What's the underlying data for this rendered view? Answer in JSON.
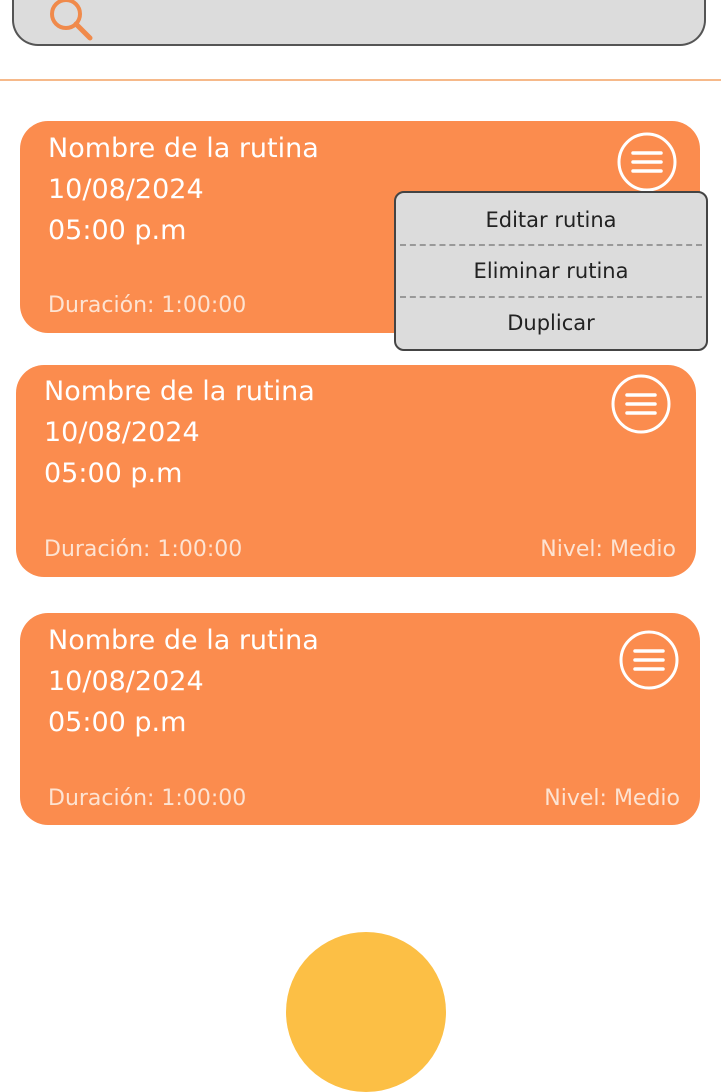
{
  "search": {
    "placeholder": "",
    "value": "",
    "icon": "search-icon"
  },
  "colors": {
    "card_background": "#fb8c4e",
    "card_text": "#ffffff",
    "search_background": "#dcdcdc",
    "menu_background": "#dcdcdc",
    "divider": "#f6b98a",
    "fab": "#fcbf45"
  },
  "routines": [
    {
      "name": "Nombre de la rutina",
      "date": "10/08/2024",
      "time": "05:00 p.m",
      "duration": "Duración: 1:00:00",
      "level": "",
      "menu_icon": "menu-icon"
    },
    {
      "name": "Nombre de la rutina",
      "date": "10/08/2024",
      "time": "05:00 p.m",
      "duration": "Duración: 1:00:00",
      "level": "Nivel: Medio",
      "menu_icon": "menu-icon"
    },
    {
      "name": "Nombre de la rutina",
      "date": "10/08/2024",
      "time": "05:00 p.m",
      "duration": "Duración: 1:00:00",
      "level": "Nivel: Medio",
      "menu_icon": "menu-icon"
    }
  ],
  "context_menu": {
    "items": [
      "Editar rutina",
      "Eliminar rutina",
      "Duplicar"
    ]
  }
}
